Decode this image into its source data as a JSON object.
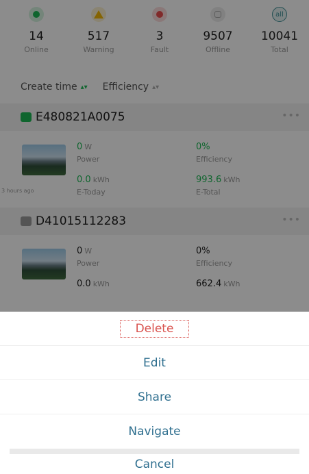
{
  "stats": [
    {
      "count": "14",
      "label": "Online",
      "icon": "online-dot-icon"
    },
    {
      "count": "517",
      "label": "Warning",
      "icon": "warning-triangle-icon"
    },
    {
      "count": "3",
      "label": "Fault",
      "icon": "fault-dot-icon"
    },
    {
      "count": "9507",
      "label": "Offline",
      "icon": "offline-icon"
    },
    {
      "count": "10041",
      "label": "Total",
      "icon": "total-badge-icon",
      "badge": "all"
    }
  ],
  "sort": {
    "create_time": "Create time",
    "efficiency": "Efficiency"
  },
  "devices": [
    {
      "serial": "E480821A0075",
      "status_color": "#1db955",
      "power_value": "0",
      "power_unit": "W",
      "power_label": "Power",
      "efficiency_value": "0%",
      "efficiency_label": "Efficiency",
      "etoday_value": "0.0",
      "etoday_unit": "kWh",
      "etoday_label": "E-Today",
      "etotal_value": "993.6",
      "etotal_unit": "kWh",
      "etotal_label": "E-Total",
      "updated": "3 hours ago"
    },
    {
      "serial": "D41015112283",
      "status_color": "#9a9a9a",
      "power_value": "0",
      "power_unit": "W",
      "power_label": "Power",
      "efficiency_value": "0%",
      "efficiency_label": "Efficiency",
      "etoday_value": "0.0",
      "etoday_unit": "kWh",
      "etotal_value": "662.4",
      "etotal_unit": "kWh"
    }
  ],
  "action_sheet": {
    "delete": "Delete",
    "edit": "Edit",
    "share": "Share",
    "navigate": "Navigate",
    "cancel": "Cancel"
  },
  "colors": {
    "accent_green": "#1db955",
    "action_blue": "#2f6f8f",
    "delete_red": "#d9534f"
  }
}
